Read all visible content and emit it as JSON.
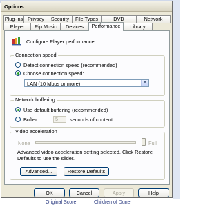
{
  "window": {
    "title": "Options"
  },
  "tabs": {
    "row1": [
      "Plug-ins",
      "Privacy",
      "Security",
      "File Types",
      "DVD",
      "Network"
    ],
    "row2": [
      "Player",
      "Rip Music",
      "Devices",
      "Performance",
      "Library"
    ],
    "active": "Performance"
  },
  "header": {
    "icon": "performance-icon",
    "text": "Configure Player performance."
  },
  "connection_speed": {
    "legend": "Connection speed",
    "detect_label": "Detect connection speed (recommended)",
    "choose_label": "Choose connection speed:",
    "selected": "choose",
    "dropdown_value": "LAN (10 Mbps or more)"
  },
  "network_buffering": {
    "legend": "Network buffering",
    "default_label": "Use default buffering (recommended)",
    "buffer_label": "Buffer",
    "buffer_value": "5",
    "seconds_label": "seconds of content",
    "selected": "default"
  },
  "video_acceleration": {
    "legend": "Video acceleration",
    "none_label": "None",
    "full_label": "Full",
    "slider_level": "full",
    "note": "Advanced video acceleration setting selected. Click Restore Defaults to use the slider.",
    "advanced_button": "Advanced...",
    "restore_button": "Restore Defaults"
  },
  "footer": {
    "ok": "OK",
    "cancel": "Cancel",
    "apply": "Apply",
    "help": "Help"
  },
  "background": {
    "left_text": "Original Score",
    "right_text": "Children of Dune"
  }
}
